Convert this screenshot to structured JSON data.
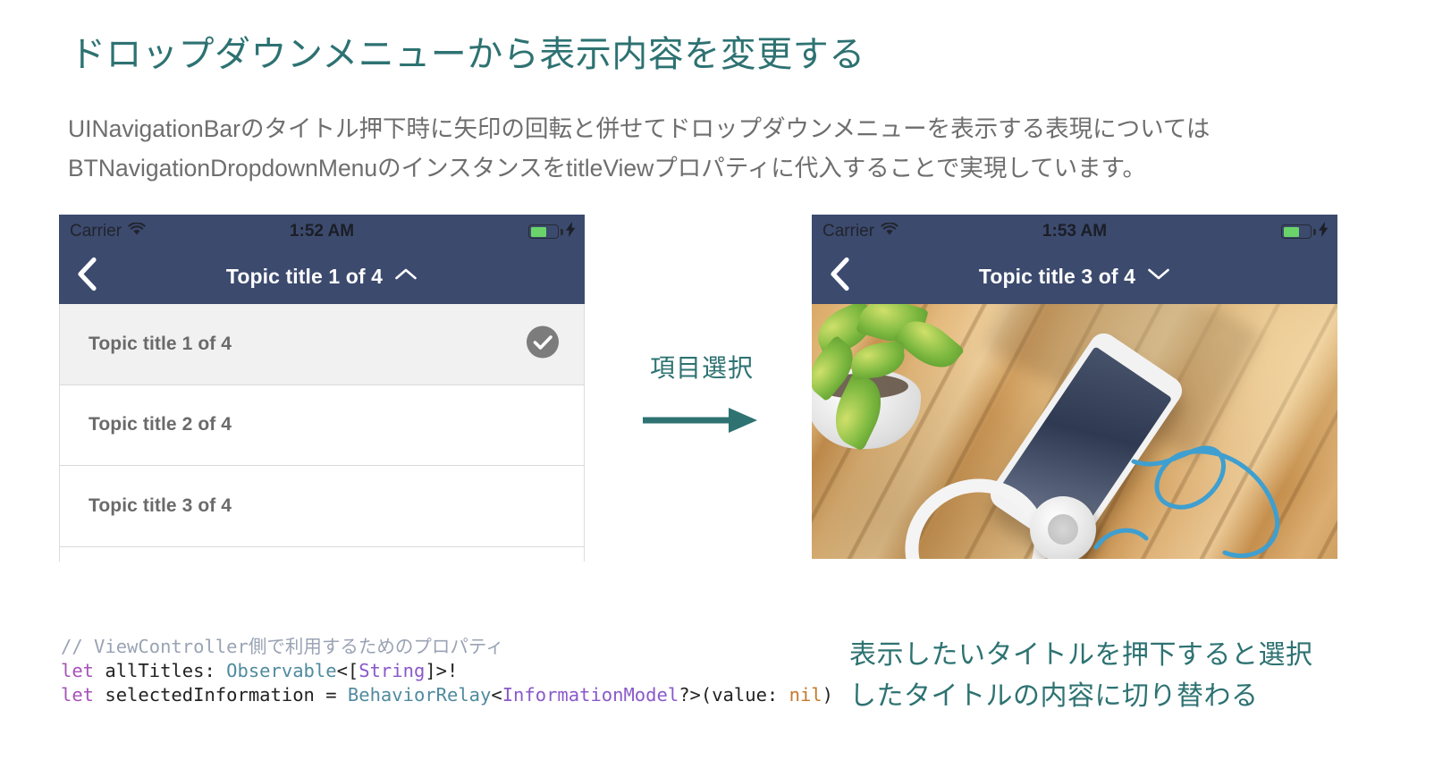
{
  "slide": {
    "title": "ドロップダウンメニューから表示内容を変更する",
    "body": "UINavigationBarのタイトル押下時に矢印の回転と併せてドロップダウンメニューを表示する表現についてはBTNavigationDropdownMenuのインスタンスをtitleViewプロパティに代入することで実現しています。",
    "accent_color": "#2e7272",
    "body_color": "#6e6e6e"
  },
  "phone_left": {
    "status_bar": {
      "carrier": "Carrier",
      "wifi_icon": "wifi-icon",
      "time": "1:52 AM",
      "battery_icon": "battery-icon",
      "charging_icon": "lightning-bolt-icon"
    },
    "nav_bar": {
      "back_icon": "chevron-left-icon",
      "title": "Topic title 1 of 4",
      "chevron_icon": "chevron-up-icon",
      "background_color": "#3c4a6e"
    },
    "dropdown_items": [
      {
        "label": "Topic title 1 of 4",
        "selected": true,
        "check_icon": "check-circle-icon"
      },
      {
        "label": "Topic title 2 of 4",
        "selected": false,
        "check_icon": ""
      },
      {
        "label": "Topic title 3 of 4",
        "selected": false,
        "check_icon": ""
      }
    ]
  },
  "phone_right": {
    "status_bar": {
      "carrier": "Carrier",
      "wifi_icon": "wifi-icon",
      "time": "1:53 AM",
      "battery_icon": "battery-icon",
      "charging_icon": "lightning-bolt-icon"
    },
    "nav_bar": {
      "back_icon": "chevron-left-icon",
      "title": "Topic title 3 of 4",
      "chevron_icon": "chevron-down-icon",
      "background_color": "#3c4a6e"
    },
    "content_photo": "wooden-deck-with-plant-smartphone-and-headphones-photo"
  },
  "transition": {
    "label": "項目選択",
    "arrow_icon": "arrow-right-icon",
    "color": "#2e7272"
  },
  "code": {
    "comment": "// ViewController側で利用するためのプロパティ",
    "line2": {
      "keyword": "let",
      "name": " allTitles: ",
      "type": "Observable",
      "open": "<[",
      "generic": "String",
      "close": "]>!"
    },
    "line3": {
      "keyword": "let",
      "name": " selectedInformation = ",
      "type": "BehaviorRelay",
      "open": "<",
      "generic": "InformationModel",
      "mid": "?>(value: ",
      "nil": "nil",
      "close": ")"
    }
  },
  "caption_right": "表示したいタイトルを押下すると選択したタイトルの内容に切り替わる"
}
